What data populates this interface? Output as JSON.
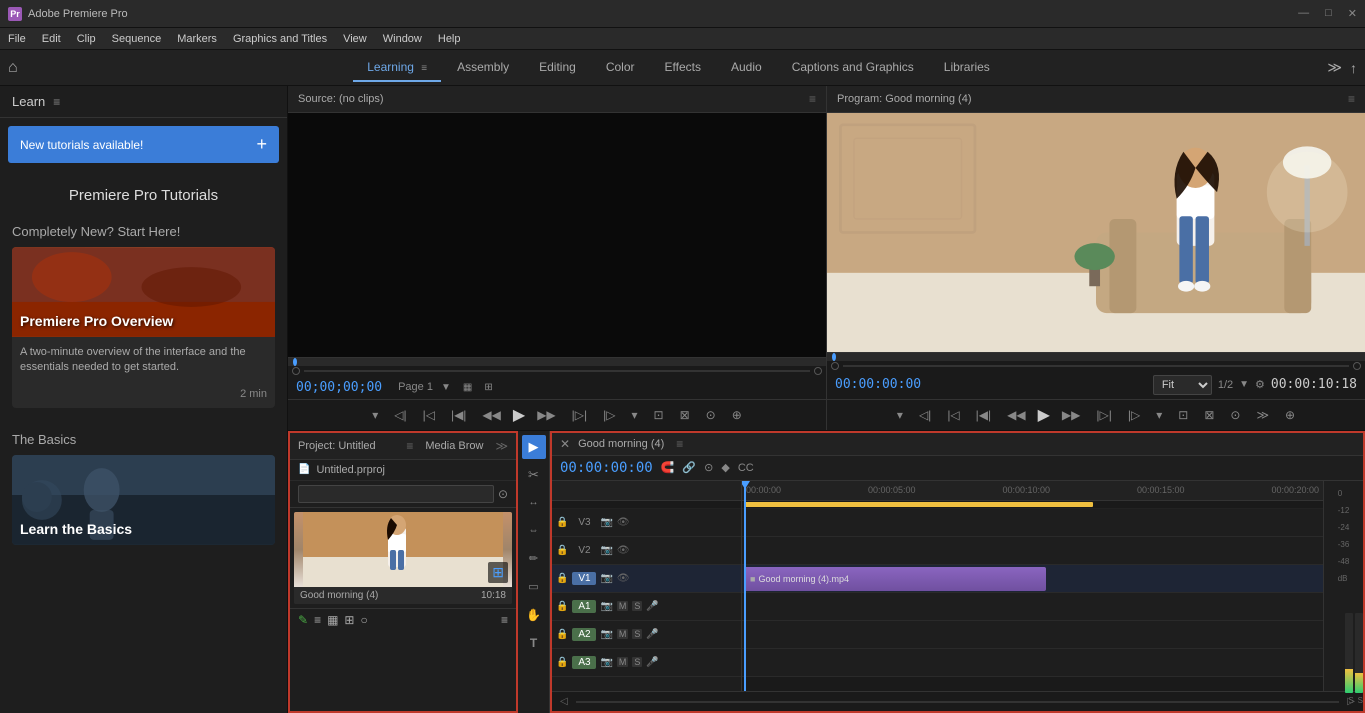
{
  "titlebar": {
    "app_name": "Adobe Premiere Pro",
    "dots": [
      "●",
      "●",
      "●"
    ],
    "window_title": "Adobe Premiere Pro",
    "min_btn": "—",
    "max_btn": "□",
    "close_btn": "✕"
  },
  "menubar": {
    "items": [
      "File",
      "Edit",
      "Clip",
      "Sequence",
      "Markers",
      "Graphics and Titles",
      "View",
      "Window",
      "Help"
    ]
  },
  "workspace": {
    "home_icon": "⌂",
    "tabs": [
      {
        "label": "Learning",
        "active": true
      },
      {
        "label": "Assembly"
      },
      {
        "label": "Editing"
      },
      {
        "label": "Color"
      },
      {
        "label": "Effects"
      },
      {
        "label": "Audio"
      },
      {
        "label": "Captions and Graphics"
      },
      {
        "label": "Libraries"
      }
    ],
    "more_icon": "≫",
    "export_icon": "↑"
  },
  "learn_panel": {
    "title": "Learn",
    "menu_icon": "≡",
    "new_tutorials_label": "New tutorials available!",
    "plus_icon": "+",
    "section_title": "Premiere Pro Tutorials",
    "section_subtitle": "Completely New? Start Here!",
    "tutorial_overview_title": "Premiere Pro Overview",
    "tutorial_overview_desc": "A two-minute overview of the interface and the essentials needed to get started.",
    "tutorial_overview_duration": "2 min",
    "basics_section": "The Basics",
    "basics_tutorial_title": "Learn the Basics"
  },
  "source_panel": {
    "title": "Source: (no clips)",
    "menu_icon": "≡",
    "timecode": "00;00;00;00",
    "page_label": "Page 1",
    "page_icon": "▼"
  },
  "program_panel": {
    "title": "Program: Good morning (4)",
    "menu_icon": "≡",
    "timecode": "00:00:00:00",
    "duration": "00:00:10:18",
    "fit_label": "Fit",
    "fraction": "1/2"
  },
  "project_panel": {
    "title": "Project: Untitled",
    "menu_icon": "≡",
    "media_browser_tab": "Media Brow",
    "more_icon": "≫",
    "file_name": "Untitled.prproj",
    "search_placeholder": "",
    "clip_name": "Good morning (4)",
    "clip_duration": "10:18"
  },
  "timeline": {
    "close_icon": "✕",
    "seq_name": "Good morning (4)",
    "menu_icon": "≡",
    "timecode": "00:00:00:00",
    "tracks": [
      {
        "id": "V3",
        "type": "video",
        "label": "V3"
      },
      {
        "id": "V2",
        "type": "video",
        "label": "V2"
      },
      {
        "id": "V1",
        "type": "video",
        "label": "V1",
        "active": true
      },
      {
        "id": "A1",
        "type": "audio",
        "label": "A1"
      },
      {
        "id": "A2",
        "type": "audio",
        "label": "A2"
      },
      {
        "id": "A3",
        "type": "audio",
        "label": "A3"
      }
    ],
    "ruler_marks": [
      "00:00:00",
      "00:00:05:00",
      "00:00:10:00",
      "00:00:15:00",
      "00:00:20:00"
    ],
    "clip_name": "Good morning (4).mp4",
    "clip_start_pct": "0%",
    "clip_width_pct": "52%"
  },
  "tools": {
    "items": [
      {
        "icon": "▶",
        "name": "selection-tool",
        "active": false
      },
      {
        "icon": "✂",
        "name": "razor-tool"
      },
      {
        "icon": "↔",
        "name": "ripple-tool"
      },
      {
        "icon": "⟺",
        "name": "rolling-tool"
      },
      {
        "icon": "✏",
        "name": "pen-tool"
      },
      {
        "icon": "▭",
        "name": "rect-tool"
      },
      {
        "icon": "✋",
        "name": "hand-tool"
      },
      {
        "icon": "T",
        "name": "type-tool"
      }
    ]
  }
}
